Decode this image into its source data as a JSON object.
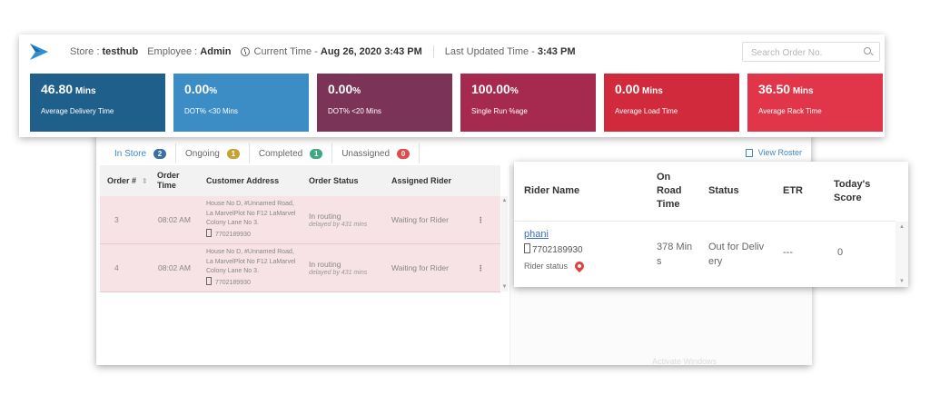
{
  "header": {
    "store_label": "Store :",
    "store_value": "testhub",
    "employee_label": "Employee :",
    "employee_value": "Admin",
    "current_time_label": "Current Time -",
    "current_time_value": "Aug 26, 2020 3:43 PM",
    "updated_label": "Last Updated Time -",
    "updated_value": "3:43 PM",
    "search_placeholder": "Search Order No."
  },
  "metrics": [
    {
      "value": "46.80",
      "unit": "Mins",
      "label": "Average Delivery Time",
      "color": "#1f5f8b"
    },
    {
      "value": "0.00",
      "unit": "%",
      "label": "DOT% <30 Mins",
      "color": "#3c8dc5"
    },
    {
      "value": "0.00",
      "unit": "%",
      "label": "DOT% <20 Mins",
      "color": "#7b3358"
    },
    {
      "value": "100.00",
      "unit": "%",
      "label": "Single Run %age",
      "color": "#a6294f"
    },
    {
      "value": "0.00",
      "unit": "Mins",
      "label": "Average Load Time",
      "color": "#d12a3d"
    },
    {
      "value": "36.50",
      "unit": "Mins",
      "label": "Average Rack Time",
      "color": "#e1354a"
    }
  ],
  "tabs": [
    {
      "label": "In Store",
      "count": "2"
    },
    {
      "label": "Ongoing",
      "count": "1"
    },
    {
      "label": "Completed",
      "count": "1"
    },
    {
      "label": "Unassigned",
      "count": "0"
    }
  ],
  "view_roster": "View Roster",
  "orders": {
    "columns": [
      "Order #",
      "Order Time",
      "Customer Address",
      "Order Status",
      "Assigned Rider"
    ],
    "rows": [
      {
        "order_no": "3",
        "time": "08:02 AM",
        "address": [
          "House No D, #Unnamed Road,",
          "La MarvelPlot No F12 LaMarvel",
          "Colony Lane No 3."
        ],
        "phone": "7702189930",
        "status": "In routing",
        "delay": "delayed by 431 mins",
        "rider": "Waiting for Rider"
      },
      {
        "order_no": "4",
        "time": "08:02 AM",
        "address": [
          "House No D, #Unnamed Road,",
          "La MarvelPlot No F12 LaMarvel",
          "Colony Lane No 3."
        ],
        "phone": "7702189930",
        "status": "In routing",
        "delay": "delayed by 431 mins",
        "rider": "Waiting for Rider"
      }
    ]
  },
  "riders": {
    "columns": [
      "Rider Name",
      "On Road Time",
      "Status",
      "ETR",
      "Today's Score"
    ],
    "rows": [
      {
        "name": "phani",
        "phone": "7702189930",
        "status_label": "Rider status",
        "on_road_time": "378 Min s",
        "status": "Out for Deliv ery",
        "etr": "---",
        "score": "0"
      }
    ]
  },
  "faded_text": "Activate Windows"
}
